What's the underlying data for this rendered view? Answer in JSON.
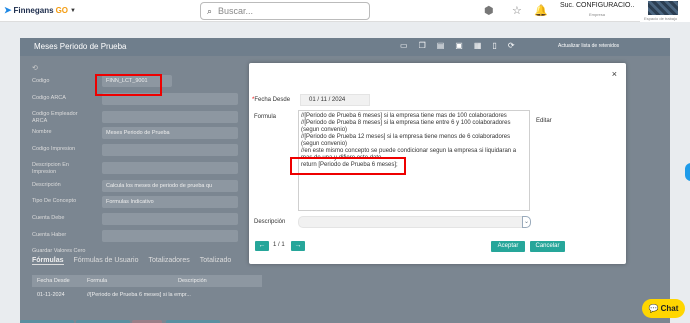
{
  "topbar": {
    "logo": "Finnegans",
    "logo_suffix": "GO",
    "logo_icon": "arrow-logo-icon",
    "search_placeholder": "Buscar...",
    "company_name": "Suc. CONFIGURACIO...",
    "company_label": "Empresa",
    "workspace_label": "Espacio de trabajo"
  },
  "page": {
    "title": "Meses Periodo de Prueba",
    "toolbar_link": "Actualizar lista de retenidos",
    "fields": [
      {
        "label": "Codigo",
        "value": "FINN_LCT_9001"
      },
      {
        "label": "Codigo ARCA",
        "value": ""
      },
      {
        "label": "Codigo Empleador ARCA",
        "value": ""
      },
      {
        "label": "Nombre",
        "value": "Meses Periodo de Prueba"
      },
      {
        "label": "Codigo Impresion",
        "value": ""
      },
      {
        "label": "Descripcion En Impresion",
        "value": ""
      },
      {
        "label": "Descripción",
        "value": "Calcula los meses de periodo de prueba qu"
      },
      {
        "label": "Tipo De Concepto",
        "value": "Formulas Indicativo"
      },
      {
        "label": "Cuenta Debe",
        "value": ""
      },
      {
        "label": "Cuenta Haber",
        "value": ""
      },
      {
        "label": "Guardar Valores Cero",
        "value": ""
      }
    ],
    "tabs": [
      "Fórmulas",
      "Fórmulas de Usuario",
      "Totalizadores",
      "Totalizado"
    ],
    "table": {
      "headers": [
        "Fecha Desde",
        "Formula",
        "Descripción"
      ],
      "rows": [
        [
          "01-11-2024",
          "//[Periodo de Prueba 6 meses] si la empr...",
          ""
        ]
      ]
    }
  },
  "modal": {
    "fecha_desde_label": "Fecha Desde",
    "fecha_desde_value": "01 / 11 / 2024",
    "formula_label": "Formula",
    "formula_text": "//[Periodo de Prueba 6 meses] si la empresa tiene mas de 100 colaboradores\n//[Periodo de Prueba 8 meses] si la empresa tiene entre 6 y 100 colaboradores (segun convenio)\n//[Periodo de Prueba 12 meses] si la empresa tiene menos de 6 colaboradores (segun convenio)\n//en este mismo concepto se puede condicionar segun la empresa si liquidaran a mas de una y difiere este dato\nreturn [Periodo de Prueba 6 meses];",
    "editar_label": "Editar",
    "descripcion_label": "Descripción",
    "descripcion_value": "",
    "pagination": "1 / 1",
    "prev_icon": "←",
    "next_icon": "→",
    "aceptar_label": "Aceptar",
    "cancelar_label": "Cancelar",
    "close_icon": "×"
  },
  "chat": {
    "label": "Chat"
  },
  "colors": {
    "accent": "#26a69a",
    "highlight": "#e00000",
    "chat": "#ffd600"
  }
}
